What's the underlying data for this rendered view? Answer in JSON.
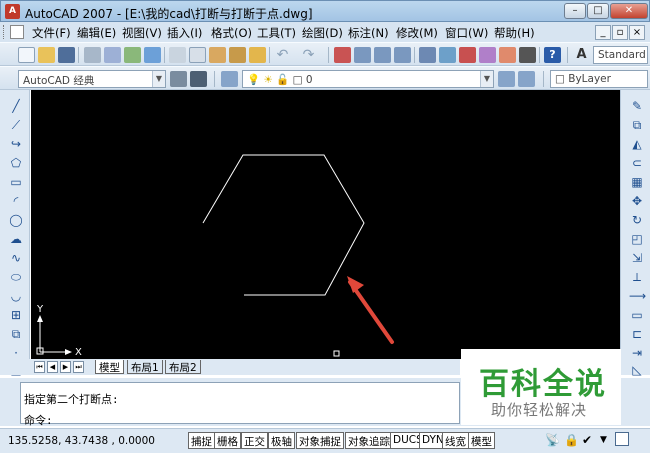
{
  "window": {
    "title": "AutoCAD 2007 - [E:\\我的cad\\打断与打断于点.dwg]",
    "app_icon": "A"
  },
  "menu": [
    "文件(F)",
    "编辑(E)",
    "视图(V)",
    "插入(I)",
    "格式(O)",
    "工具(T)",
    "绘图(D)",
    "标注(N)",
    "修改(M)",
    "窗口(W)",
    "帮助(H)"
  ],
  "toolbar": {
    "text_style": "Standard",
    "workspace": "AutoCAD 经典",
    "layer": "0",
    "linetype": "ByLayer"
  },
  "canvas": {
    "axis_y": "Y",
    "axis_x": "X"
  },
  "layout_tabs": [
    "模型",
    "布局1",
    "布局2"
  ],
  "command": {
    "history": "指定第二个打断点:",
    "prompt": "命令:"
  },
  "watermark": {
    "title": "百科全说",
    "subtitle": "助你轻松解决"
  },
  "status": {
    "coords": "135.5258,  43.7438 , 0.0000",
    "buttons": [
      "捕捉",
      "栅格",
      "正交",
      "极轴",
      "对象捕捉",
      "对象追踪",
      "DUCS",
      "DYN",
      "线宽",
      "模型"
    ]
  },
  "colors": {
    "canvas_bg": "#000000",
    "drawing_line": "#ffffff",
    "annotation_arrow": "#e0483a",
    "watermark_green": "#2f9b36"
  }
}
